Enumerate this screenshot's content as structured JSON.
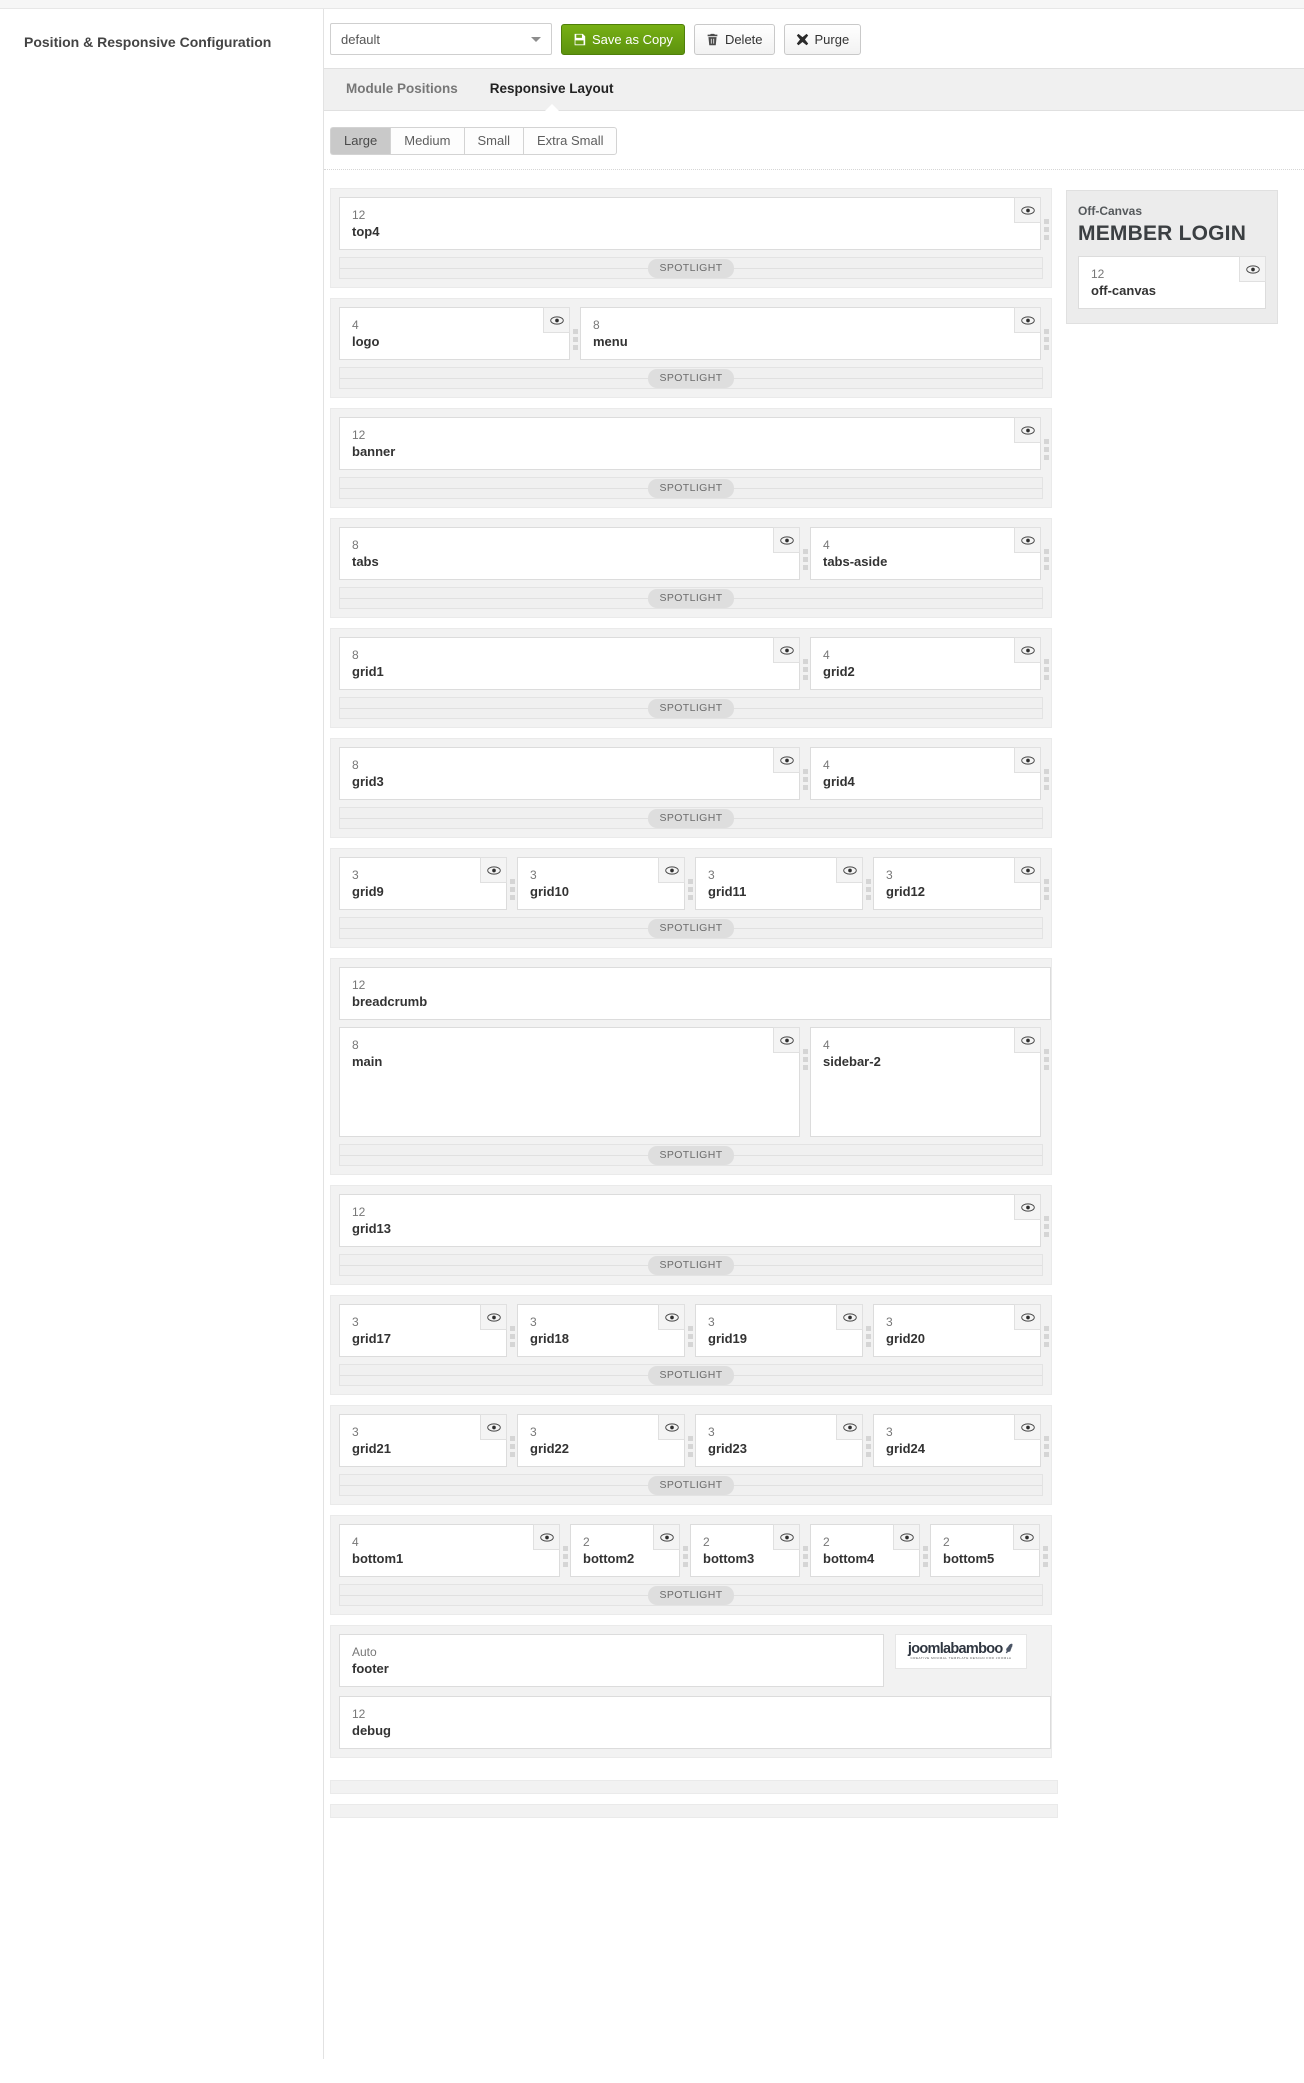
{
  "left": {
    "heading": "Position & Responsive Configuration"
  },
  "toolbar": {
    "style_select_value": "default",
    "style_select_options": [
      "default"
    ],
    "save_as_copy_label": "Save as Copy",
    "delete_label": "Delete",
    "purge_label": "Purge",
    "save_icon": "floppy-disk-icon",
    "delete_icon": "trash-icon",
    "purge_icon": "x-mark-icon",
    "green": "#67a010"
  },
  "tabs": [
    {
      "label": "Module Positions",
      "active": false
    },
    {
      "label": "Responsive Layout",
      "active": true
    }
  ],
  "breakpoints": [
    {
      "label": "Large",
      "active": true
    },
    {
      "label": "Medium",
      "active": false
    },
    {
      "label": "Small",
      "active": false
    },
    {
      "label": "Extra Small",
      "active": false
    }
  ],
  "spotlight_label": "SPOTLIGHT",
  "eye_icon": "eye-icon",
  "grip_icon": "drag-handle-icon",
  "rows": [
    {
      "spotlight": true,
      "cols": [
        {
          "num": "12",
          "pos": "top4",
          "w": 12,
          "eye": true
        }
      ]
    },
    {
      "spotlight": true,
      "cols": [
        {
          "num": "4",
          "pos": "logo",
          "w": 4,
          "eye": true
        },
        {
          "num": "8",
          "pos": "menu",
          "w": 8,
          "eye": true
        }
      ]
    },
    {
      "spotlight": true,
      "cols": [
        {
          "num": "12",
          "pos": "banner",
          "w": 12,
          "eye": true
        }
      ]
    },
    {
      "spotlight": true,
      "cols": [
        {
          "num": "8",
          "pos": "tabs",
          "w": 8,
          "eye": true
        },
        {
          "num": "4",
          "pos": "tabs-aside",
          "w": 4,
          "eye": true
        }
      ]
    },
    {
      "spotlight": true,
      "cols": [
        {
          "num": "8",
          "pos": "grid1",
          "w": 8,
          "eye": true
        },
        {
          "num": "4",
          "pos": "grid2",
          "w": 4,
          "eye": true
        }
      ]
    },
    {
      "spotlight": true,
      "cols": [
        {
          "num": "8",
          "pos": "grid3",
          "w": 8,
          "eye": true
        },
        {
          "num": "4",
          "pos": "grid4",
          "w": 4,
          "eye": true
        }
      ]
    },
    {
      "spotlight": true,
      "cols": [
        {
          "num": "3",
          "pos": "grid9",
          "w": 3,
          "eye": true
        },
        {
          "num": "3",
          "pos": "grid10",
          "w": 3,
          "eye": true
        },
        {
          "num": "3",
          "pos": "grid11",
          "w": 3,
          "eye": true
        },
        {
          "num": "3",
          "pos": "grid12",
          "w": 3,
          "eye": true
        }
      ]
    },
    {
      "spotlight": true,
      "tall": true,
      "pre_cols": [
        {
          "num": "12",
          "pos": "breadcrumb",
          "w": 12,
          "eye": false
        }
      ],
      "cols": [
        {
          "num": "8",
          "pos": "main",
          "w": 8,
          "eye": true
        },
        {
          "num": "4",
          "pos": "sidebar-2",
          "w": 4,
          "eye": true,
          "tall": true
        }
      ]
    },
    {
      "spotlight": true,
      "cols": [
        {
          "num": "12",
          "pos": "grid13",
          "w": 12,
          "eye": true
        }
      ]
    },
    {
      "spotlight": true,
      "cols": [
        {
          "num": "3",
          "pos": "grid17",
          "w": 3,
          "eye": true
        },
        {
          "num": "3",
          "pos": "grid18",
          "w": 3,
          "eye": true
        },
        {
          "num": "3",
          "pos": "grid19",
          "w": 3,
          "eye": true
        },
        {
          "num": "3",
          "pos": "grid20",
          "w": 3,
          "eye": true
        }
      ]
    },
    {
      "spotlight": true,
      "cols": [
        {
          "num": "3",
          "pos": "grid21",
          "w": 3,
          "eye": true
        },
        {
          "num": "3",
          "pos": "grid22",
          "w": 3,
          "eye": true
        },
        {
          "num": "3",
          "pos": "grid23",
          "w": 3,
          "eye": true
        },
        {
          "num": "3",
          "pos": "grid24",
          "w": 3,
          "eye": true
        }
      ]
    },
    {
      "spotlight": true,
      "cols": [
        {
          "num": "4",
          "pos": "bottom1",
          "w": 4,
          "eye": true
        },
        {
          "num": "2",
          "pos": "bottom2",
          "w": 2,
          "eye": true
        },
        {
          "num": "2",
          "pos": "bottom3",
          "w": 2,
          "eye": true
        },
        {
          "num": "2",
          "pos": "bottom4",
          "w": 2,
          "eye": true
        },
        {
          "num": "2",
          "pos": "bottom5",
          "w": 2,
          "eye": true
        }
      ]
    },
    {
      "spotlight": false,
      "footer": true,
      "cols": [
        {
          "num": "Auto",
          "pos": "footer",
          "w": 9,
          "eye": false
        }
      ],
      "logo": {
        "wordmark": "joomlabamboo",
        "tagline": "CREATIVE MINIMAL TEMPLATE DESIGN FOR JOOMLA",
        "leaf": "leaf-icon"
      },
      "post_cols": [
        {
          "num": "12",
          "pos": "debug",
          "w": 12,
          "eye": false
        }
      ]
    }
  ],
  "offcanvas": {
    "label": "Off-Canvas",
    "title": "MEMBER LOGIN",
    "col": {
      "num": "12",
      "pos": "off-canvas",
      "eye": true
    }
  }
}
